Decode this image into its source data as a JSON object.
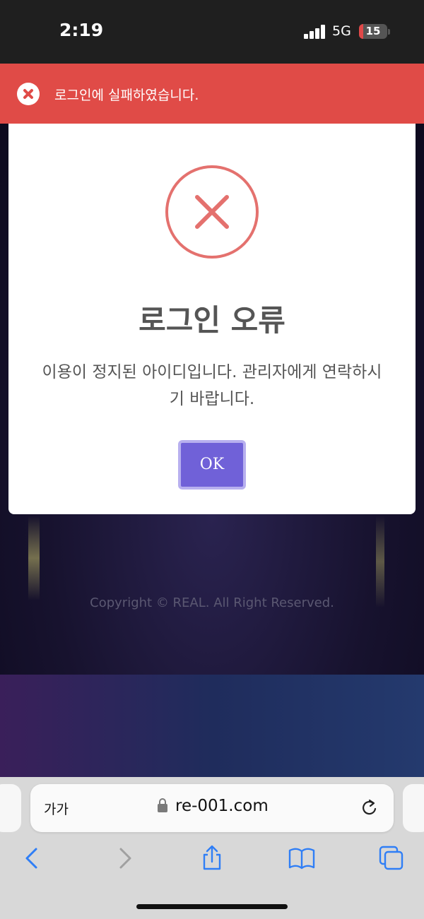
{
  "status_bar": {
    "time": "2:19",
    "network": "5G",
    "battery": "15",
    "battery_level": 0.15
  },
  "toast": {
    "message": "로그인에 실패하였습니다."
  },
  "modal": {
    "title": "로그인 오류",
    "message": "이용이 정지된 아이디입니다. 관리자에게 연락하시기 바랍니다.",
    "ok_label": "OK"
  },
  "page": {
    "copyright": "Copyright © REAL. All Right Reserved."
  },
  "browser": {
    "text_size_label": "가가",
    "url": "re-001.com"
  },
  "colors": {
    "toast_bg": "#e04b47",
    "ok_button": "#7061d8",
    "error_ring": "#e4716e"
  },
  "icons": [
    "close-icon",
    "error-x-icon",
    "lock-icon",
    "reload-icon",
    "back-icon",
    "forward-icon",
    "share-icon",
    "bookmarks-icon",
    "tabs-icon"
  ]
}
